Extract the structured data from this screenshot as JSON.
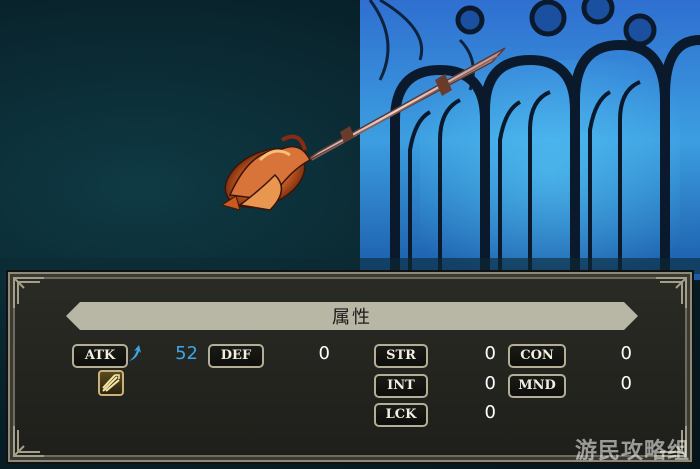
{
  "panel": {
    "title": "属性"
  },
  "stats": {
    "atk": {
      "label": "ATK",
      "value": "52"
    },
    "def": {
      "label": "DEF",
      "value": "0"
    },
    "str": {
      "label": "STR",
      "value": "0"
    },
    "int": {
      "label": "INT",
      "value": "0"
    },
    "lck": {
      "label": "LCK",
      "value": "0"
    },
    "con": {
      "label": "CON",
      "value": "0"
    },
    "mnd": {
      "label": "MND",
      "value": "0"
    }
  },
  "icons": {
    "atk_change": "up-arrow-icon",
    "element": "slash-attack-icon"
  },
  "colors": {
    "value_increase": "#3aa8e8",
    "panel_title_bar": "#b8b6a5"
  },
  "watermark": "游民攻略组"
}
